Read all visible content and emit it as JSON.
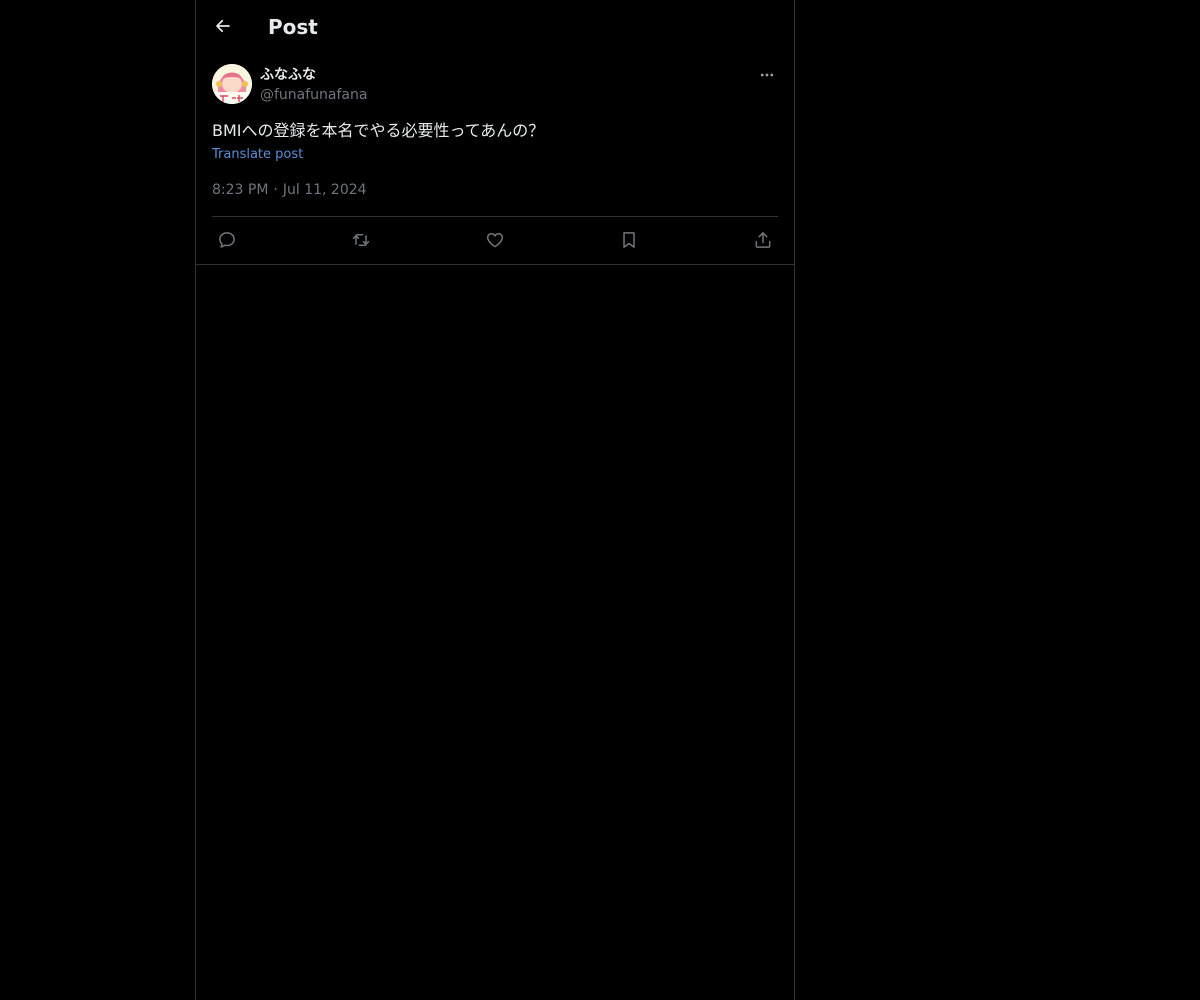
{
  "header": {
    "title": "Post",
    "back_icon": "arrow-left-icon"
  },
  "post": {
    "author": {
      "display_name": "ふなふな",
      "handle": "@funafunafana",
      "avatar_icon": "user-avatar"
    },
    "more_icon": "more-horizontal-icon",
    "text": "BMIへの登録を本名でやる必要性ってあんの？",
    "translate_label": "Translate post",
    "time": "8:23 PM",
    "separator": "·",
    "date": "Jul 11, 2024",
    "actions": [
      {
        "name": "reply",
        "icon": "reply-icon"
      },
      {
        "name": "repost",
        "icon": "repost-icon"
      },
      {
        "name": "like",
        "icon": "heart-icon"
      },
      {
        "name": "bookmark",
        "icon": "bookmark-icon"
      },
      {
        "name": "share",
        "icon": "share-icon"
      }
    ]
  },
  "colors": {
    "background": "#000000",
    "text_primary": "#e7e9ea",
    "text_secondary": "#71767b",
    "link": "#5d8fd6",
    "border": "#2f3336"
  }
}
